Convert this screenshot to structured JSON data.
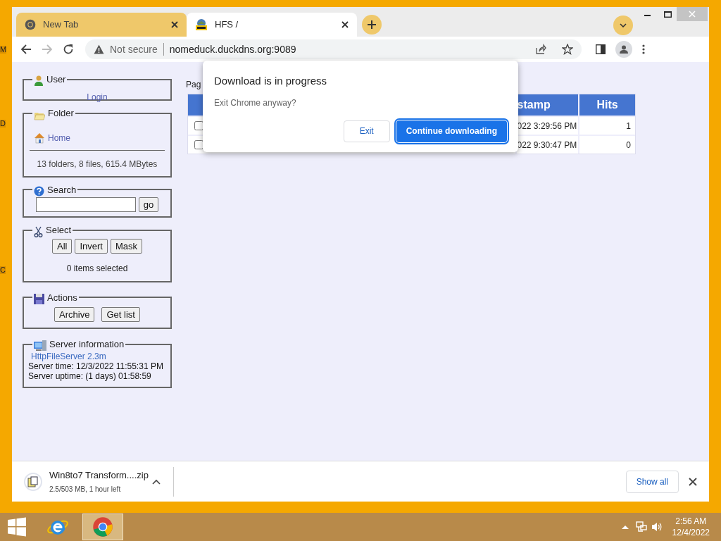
{
  "desktop_labels": [
    "M",
    "D",
    "C"
  ],
  "tabs": [
    {
      "title": "New Tab",
      "selected": false,
      "kind": "chrome"
    },
    {
      "title": "HFS /",
      "selected": true,
      "kind": "hfs"
    }
  ],
  "address_bar": {
    "security": "Not secure",
    "url": "nomeduck.duckdns.org:9089"
  },
  "sidebar": {
    "user": {
      "title": "User",
      "link": "Login"
    },
    "folder": {
      "title": "Folder",
      "link": "Home",
      "summary": "13 folders, 8 files, 615.4 MBytes"
    },
    "search": {
      "title": "Search",
      "button": "go"
    },
    "select": {
      "title": "Select",
      "buttons": [
        "All",
        "Invert",
        "Mask"
      ],
      "status": "0 items selected"
    },
    "actions": {
      "title": "Actions",
      "buttons": [
        "Archive",
        "Get list"
      ]
    },
    "server": {
      "title": "Server information",
      "link": "HttpFileServer 2.3m",
      "lines": [
        "Server time: 12/3/2022 11:55:31 PM",
        "Server uptime: (1 days) 01:58:59"
      ]
    }
  },
  "page_label": "Pag",
  "table": {
    "columns": [
      "",
      "stamp",
      "Hits"
    ],
    "rows": [
      {
        "checked": false,
        "cells": [
          "",
          "022 3:29:56 PM",
          "1"
        ]
      },
      {
        "checked": false,
        "cells": [
          "",
          "022 9:30:47 PM",
          "0"
        ]
      }
    ]
  },
  "dialog": {
    "title": "Download is in progress",
    "message": "Exit Chrome anyway?",
    "buttons": [
      {
        "label": "Exit",
        "kind": "secondary"
      },
      {
        "label": "Continue downloading",
        "kind": "primary"
      }
    ]
  },
  "download_bar": {
    "file": "Win8to7 Transform....zip",
    "progress": "2.5/503 MB, 1 hour left",
    "show_all": "Show all"
  },
  "taskbar": {
    "apps": [
      {
        "kind": "ie",
        "selected": false
      },
      {
        "kind": "chrome",
        "selected": true
      }
    ],
    "time": "2:56 AM",
    "date": "12/4/2022"
  }
}
